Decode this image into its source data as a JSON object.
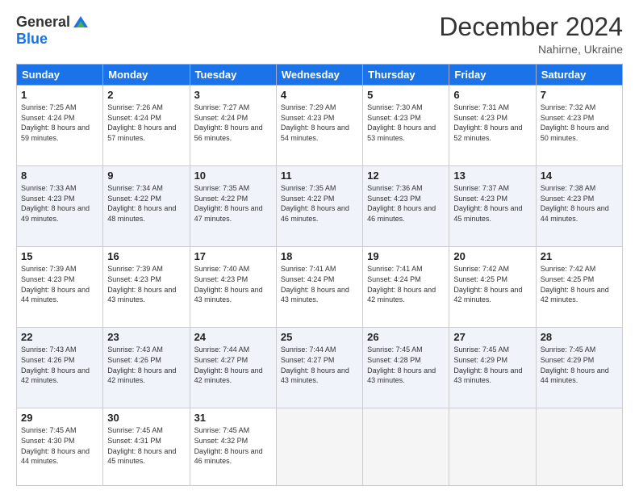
{
  "header": {
    "logo_general": "General",
    "logo_blue": "Blue",
    "month_title": "December 2024",
    "location": "Nahirne, Ukraine"
  },
  "days_of_week": [
    "Sunday",
    "Monday",
    "Tuesday",
    "Wednesday",
    "Thursday",
    "Friday",
    "Saturday"
  ],
  "weeks": [
    [
      {
        "day": "1",
        "sunrise": "Sunrise: 7:25 AM",
        "sunset": "Sunset: 4:24 PM",
        "daylight": "Daylight: 8 hours and 59 minutes."
      },
      {
        "day": "2",
        "sunrise": "Sunrise: 7:26 AM",
        "sunset": "Sunset: 4:24 PM",
        "daylight": "Daylight: 8 hours and 57 minutes."
      },
      {
        "day": "3",
        "sunrise": "Sunrise: 7:27 AM",
        "sunset": "Sunset: 4:24 PM",
        "daylight": "Daylight: 8 hours and 56 minutes."
      },
      {
        "day": "4",
        "sunrise": "Sunrise: 7:29 AM",
        "sunset": "Sunset: 4:23 PM",
        "daylight": "Daylight: 8 hours and 54 minutes."
      },
      {
        "day": "5",
        "sunrise": "Sunrise: 7:30 AM",
        "sunset": "Sunset: 4:23 PM",
        "daylight": "Daylight: 8 hours and 53 minutes."
      },
      {
        "day": "6",
        "sunrise": "Sunrise: 7:31 AM",
        "sunset": "Sunset: 4:23 PM",
        "daylight": "Daylight: 8 hours and 52 minutes."
      },
      {
        "day": "7",
        "sunrise": "Sunrise: 7:32 AM",
        "sunset": "Sunset: 4:23 PM",
        "daylight": "Daylight: 8 hours and 50 minutes."
      }
    ],
    [
      {
        "day": "8",
        "sunrise": "Sunrise: 7:33 AM",
        "sunset": "Sunset: 4:23 PM",
        "daylight": "Daylight: 8 hours and 49 minutes."
      },
      {
        "day": "9",
        "sunrise": "Sunrise: 7:34 AM",
        "sunset": "Sunset: 4:22 PM",
        "daylight": "Daylight: 8 hours and 48 minutes."
      },
      {
        "day": "10",
        "sunrise": "Sunrise: 7:35 AM",
        "sunset": "Sunset: 4:22 PM",
        "daylight": "Daylight: 8 hours and 47 minutes."
      },
      {
        "day": "11",
        "sunrise": "Sunrise: 7:35 AM",
        "sunset": "Sunset: 4:22 PM",
        "daylight": "Daylight: 8 hours and 46 minutes."
      },
      {
        "day": "12",
        "sunrise": "Sunrise: 7:36 AM",
        "sunset": "Sunset: 4:23 PM",
        "daylight": "Daylight: 8 hours and 46 minutes."
      },
      {
        "day": "13",
        "sunrise": "Sunrise: 7:37 AM",
        "sunset": "Sunset: 4:23 PM",
        "daylight": "Daylight: 8 hours and 45 minutes."
      },
      {
        "day": "14",
        "sunrise": "Sunrise: 7:38 AM",
        "sunset": "Sunset: 4:23 PM",
        "daylight": "Daylight: 8 hours and 44 minutes."
      }
    ],
    [
      {
        "day": "15",
        "sunrise": "Sunrise: 7:39 AM",
        "sunset": "Sunset: 4:23 PM",
        "daylight": "Daylight: 8 hours and 44 minutes."
      },
      {
        "day": "16",
        "sunrise": "Sunrise: 7:39 AM",
        "sunset": "Sunset: 4:23 PM",
        "daylight": "Daylight: 8 hours and 43 minutes."
      },
      {
        "day": "17",
        "sunrise": "Sunrise: 7:40 AM",
        "sunset": "Sunset: 4:23 PM",
        "daylight": "Daylight: 8 hours and 43 minutes."
      },
      {
        "day": "18",
        "sunrise": "Sunrise: 7:41 AM",
        "sunset": "Sunset: 4:24 PM",
        "daylight": "Daylight: 8 hours and 43 minutes."
      },
      {
        "day": "19",
        "sunrise": "Sunrise: 7:41 AM",
        "sunset": "Sunset: 4:24 PM",
        "daylight": "Daylight: 8 hours and 42 minutes."
      },
      {
        "day": "20",
        "sunrise": "Sunrise: 7:42 AM",
        "sunset": "Sunset: 4:25 PM",
        "daylight": "Daylight: 8 hours and 42 minutes."
      },
      {
        "day": "21",
        "sunrise": "Sunrise: 7:42 AM",
        "sunset": "Sunset: 4:25 PM",
        "daylight": "Daylight: 8 hours and 42 minutes."
      }
    ],
    [
      {
        "day": "22",
        "sunrise": "Sunrise: 7:43 AM",
        "sunset": "Sunset: 4:26 PM",
        "daylight": "Daylight: 8 hours and 42 minutes."
      },
      {
        "day": "23",
        "sunrise": "Sunrise: 7:43 AM",
        "sunset": "Sunset: 4:26 PM",
        "daylight": "Daylight: 8 hours and 42 minutes."
      },
      {
        "day": "24",
        "sunrise": "Sunrise: 7:44 AM",
        "sunset": "Sunset: 4:27 PM",
        "daylight": "Daylight: 8 hours and 42 minutes."
      },
      {
        "day": "25",
        "sunrise": "Sunrise: 7:44 AM",
        "sunset": "Sunset: 4:27 PM",
        "daylight": "Daylight: 8 hours and 43 minutes."
      },
      {
        "day": "26",
        "sunrise": "Sunrise: 7:45 AM",
        "sunset": "Sunset: 4:28 PM",
        "daylight": "Daylight: 8 hours and 43 minutes."
      },
      {
        "day": "27",
        "sunrise": "Sunrise: 7:45 AM",
        "sunset": "Sunset: 4:29 PM",
        "daylight": "Daylight: 8 hours and 43 minutes."
      },
      {
        "day": "28",
        "sunrise": "Sunrise: 7:45 AM",
        "sunset": "Sunset: 4:29 PM",
        "daylight": "Daylight: 8 hours and 44 minutes."
      }
    ],
    [
      {
        "day": "29",
        "sunrise": "Sunrise: 7:45 AM",
        "sunset": "Sunset: 4:30 PM",
        "daylight": "Daylight: 8 hours and 44 minutes."
      },
      {
        "day": "30",
        "sunrise": "Sunrise: 7:45 AM",
        "sunset": "Sunset: 4:31 PM",
        "daylight": "Daylight: 8 hours and 45 minutes."
      },
      {
        "day": "31",
        "sunrise": "Sunrise: 7:45 AM",
        "sunset": "Sunset: 4:32 PM",
        "daylight": "Daylight: 8 hours and 46 minutes."
      },
      null,
      null,
      null,
      null
    ]
  ]
}
